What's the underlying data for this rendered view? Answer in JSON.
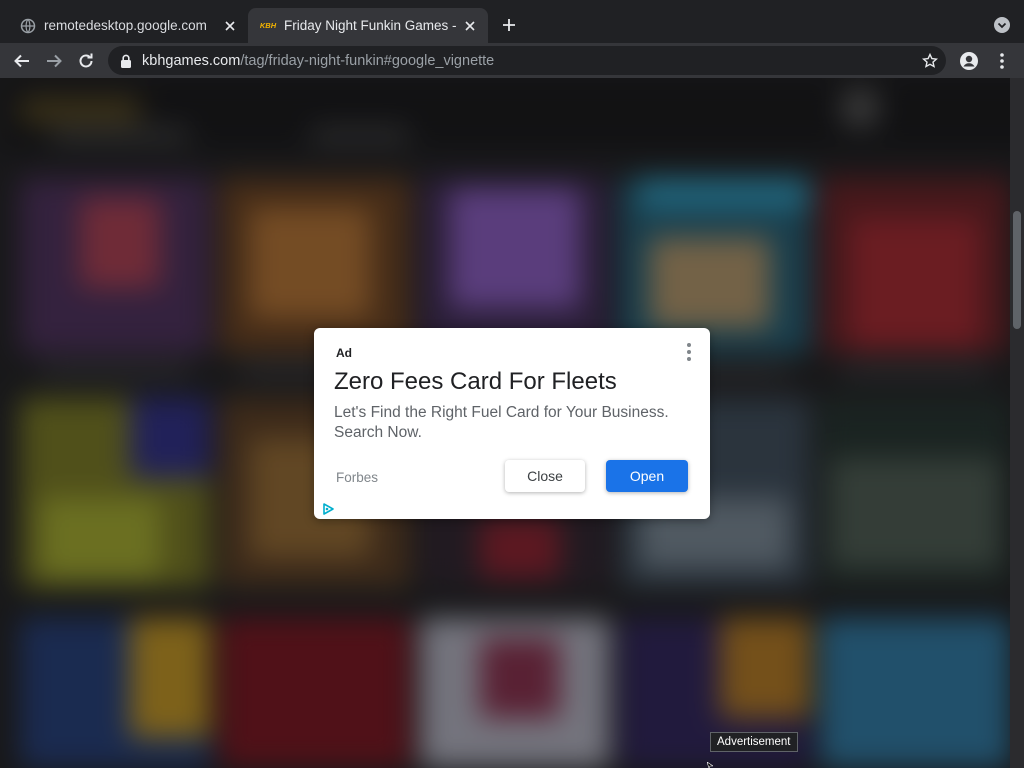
{
  "browser": {
    "tabs": [
      {
        "title": "remotedesktop.google.com",
        "active": false,
        "favicon": "globe-icon"
      },
      {
        "title": "Friday Night Funkin Games - Pl",
        "active": true,
        "favicon": "kbh-favicon",
        "favicon_text": "KBH"
      }
    ],
    "address_bar": {
      "host": "kbhgames.com",
      "path": "/tag/friday-night-funkin#google_vignette"
    }
  },
  "ad": {
    "label": "Ad",
    "headline": "Zero Fees Card For Fleets",
    "body": "Let's Find the Right Fuel Card for Your Business. Search Now.",
    "advertiser": "Forbes",
    "close_label": "Close",
    "open_label": "Open",
    "open_color": "#1a73e8"
  },
  "tooltip": {
    "text": "Advertisement"
  }
}
